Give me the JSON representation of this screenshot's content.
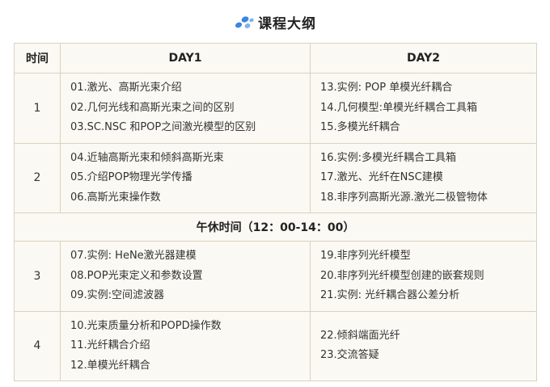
{
  "title": "课程大纲",
  "icon": "cloud-dots-icon",
  "accent_color": "#3a86e0",
  "headers": {
    "session": "时间",
    "day1": "DAY1",
    "day2": "DAY2"
  },
  "rows": [
    {
      "session": "1",
      "day1": [
        "01.激光、高斯光束介绍",
        "02.几何光线和高斯光束之间的区别",
        "03.SC.NSC 和POP之间激光模型的区别"
      ],
      "day2": [
        "13.实例: POP 单模光纤耦合",
        "14.几何模型:单模光纤耦合工具箱",
        "15.多模光纤耦合"
      ]
    },
    {
      "session": "2",
      "day1": [
        "04.近轴高斯光束和倾斜高斯光束",
        "05.介绍POP物理光学传播",
        "06.高斯光束操作数"
      ],
      "day2": [
        "16.实例:多模光纤耦合工具箱",
        "17.激光、光纤在NSC建模",
        "18.非序列高斯光源.激光二极管物体"
      ]
    },
    {
      "session": "3",
      "day1": [
        "07.实例: HeNe激光器建模",
        "08.POP光束定义和参数设置",
        "09.实例:空间滤波器"
      ],
      "day2": [
        "19.非序列光纤模型",
        "20.非序列光纤模型创建的嵌套规则",
        "21.实例: 光纤耦合器公差分析"
      ]
    },
    {
      "session": "4",
      "day1": [
        "10.光束质量分析和POPD操作数",
        "11.光纤耦合介绍",
        "12.单模光纤耦合"
      ],
      "day2": [
        "22.倾斜端面光纤",
        "23.交流答疑"
      ]
    }
  ],
  "lunch_break": "午休时间（12：00-14：00）"
}
